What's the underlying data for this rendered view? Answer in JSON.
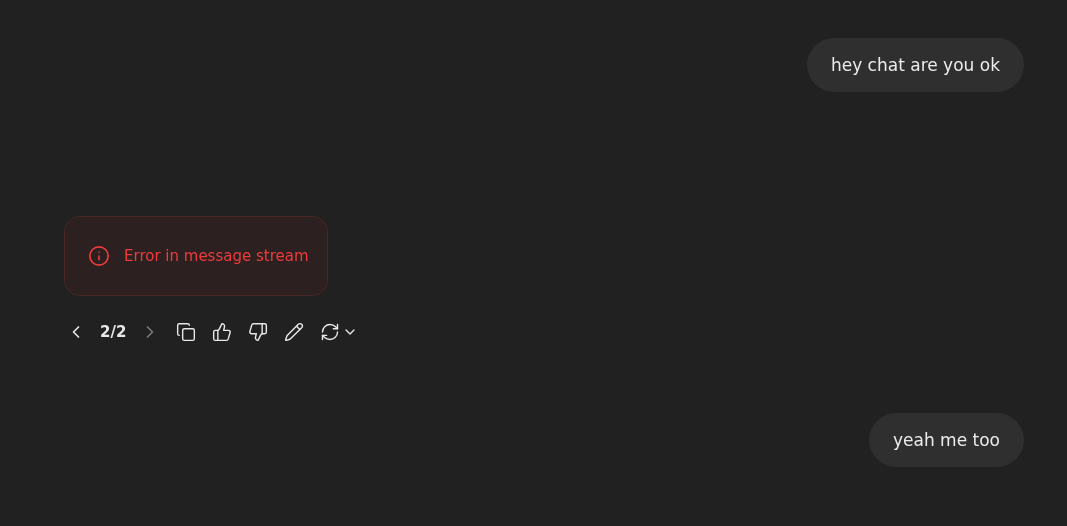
{
  "messages": [
    {
      "kind": "user",
      "text": "hey chat are you ok"
    },
    {
      "kind": "error",
      "text": "Error in message stream",
      "pager": {
        "text": "2/2",
        "prev_disabled": false,
        "next_disabled": true
      }
    },
    {
      "kind": "user",
      "text": "yeah me too"
    }
  ]
}
